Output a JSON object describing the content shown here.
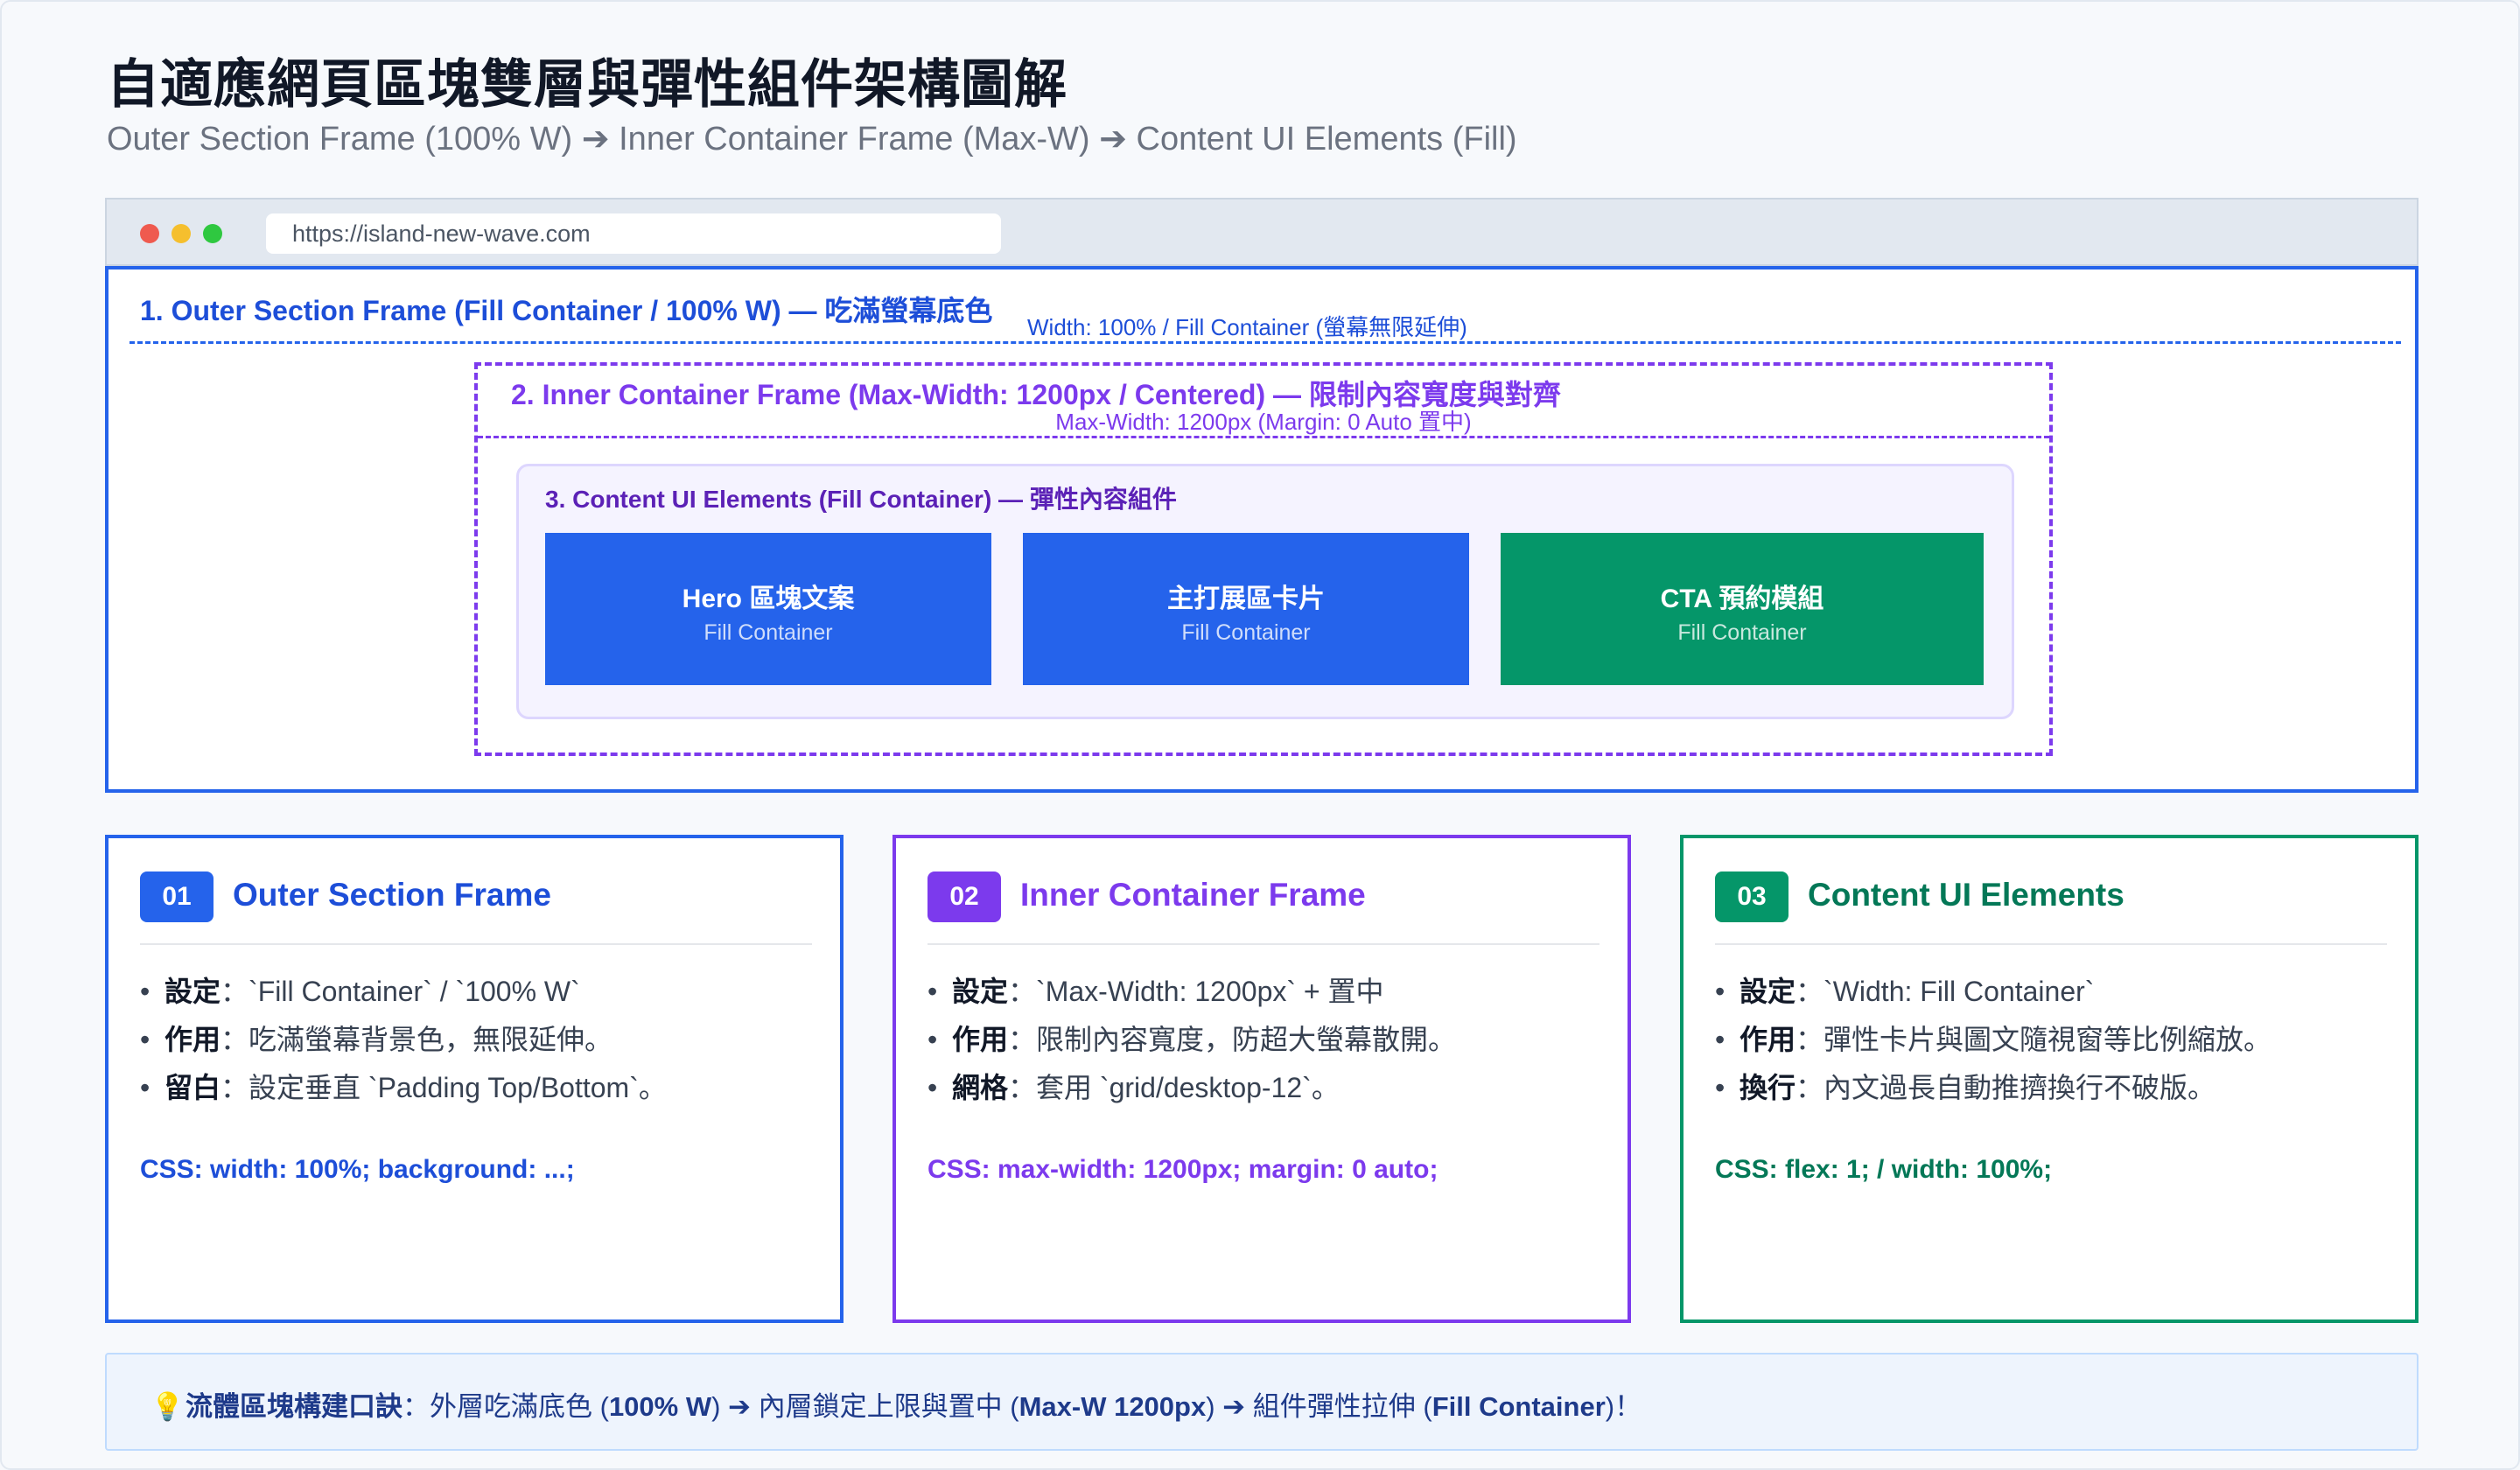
{
  "title": "自適應網頁區塊雙層與彈性組件架構圖解",
  "subtitle": "Outer Section Frame (100% W) ➔ Inner Container Frame (Max-W) ➔ Content UI Elements (Fill)",
  "browser": {
    "url": "https://island-new-wave.com",
    "dots": [
      "#ef5a4f",
      "#f5bf2e",
      "#2fc840"
    ]
  },
  "outer": {
    "label": "1. Outer Section Frame (Fill Container / 100% W) — 吃滿螢幕底色",
    "note": "Width: 100% / Fill Container (螢幕無限延伸)",
    "color": "#2563eb"
  },
  "inner": {
    "label": "2. Inner Container Frame (Max-Width: 1200px / Centered) — 限制內容寬度與對齊",
    "note": "Max-Width: 1200px (Margin: 0 Auto 置中)",
    "color": "#7c3aed"
  },
  "content": {
    "label": "3. Content UI Elements (Fill Container) — 彈性內容組件",
    "blocks": [
      {
        "title": "Hero 區塊文案",
        "sub": "Fill Container"
      },
      {
        "title": "主打展區卡片",
        "sub": "Fill Container"
      },
      {
        "title": "CTA 預約模組",
        "sub": "Fill Container"
      }
    ],
    "colors": {
      "blue": "#2563eb",
      "green": "#059669"
    }
  },
  "cards": [
    {
      "badge": "01",
      "title": "Outer Section Frame",
      "bullets": [
        {
          "key": "設定",
          "sep": "：",
          "text": "`Fill Container` / `100% W`"
        },
        {
          "key": "作用",
          "sep": "：",
          "text": "吃滿螢幕背景色，無限延伸。"
        },
        {
          "key": "留白",
          "sep": "：",
          "text": "設定垂直 `Padding Top/Bottom`。"
        }
      ],
      "css": "CSS: width: 100%; background: ...;"
    },
    {
      "badge": "02",
      "title": "Inner Container Frame",
      "bullets": [
        {
          "key": "設定",
          "sep": "：",
          "text": "`Max-Width: 1200px` + 置中"
        },
        {
          "key": "作用",
          "sep": "：",
          "text": "限制內容寬度，防超大螢幕散開。"
        },
        {
          "key": "網格",
          "sep": "：",
          "text": "套用 `grid/desktop-12`。"
        }
      ],
      "css": "CSS: max-width: 1200px; margin: 0 auto;"
    },
    {
      "badge": "03",
      "title": "Content UI Elements",
      "bullets": [
        {
          "key": "設定",
          "sep": "：",
          "text": "`Width: Fill Container`"
        },
        {
          "key": "作用",
          "sep": "：",
          "text": "彈性卡片與圖文隨視窗等比例縮放。"
        },
        {
          "key": "換行",
          "sep": "：",
          "text": "內文過長自動推擠換行不破版。"
        }
      ],
      "css": "CSS: flex: 1; / width: 100%;"
    }
  ],
  "tip": {
    "icon": "lightbulb-icon",
    "lead": "流體區塊構建口訣",
    "sep": "：",
    "part1": "外層吃滿底色 (",
    "bold1": "100% W",
    "part2": ") ➔ 內層鎖定上限與置中 (",
    "bold2": "Max-W 1200px",
    "part3": ") ➔ 組件彈性拉伸 (",
    "bold3": "Fill Container",
    "part4": ")！"
  }
}
